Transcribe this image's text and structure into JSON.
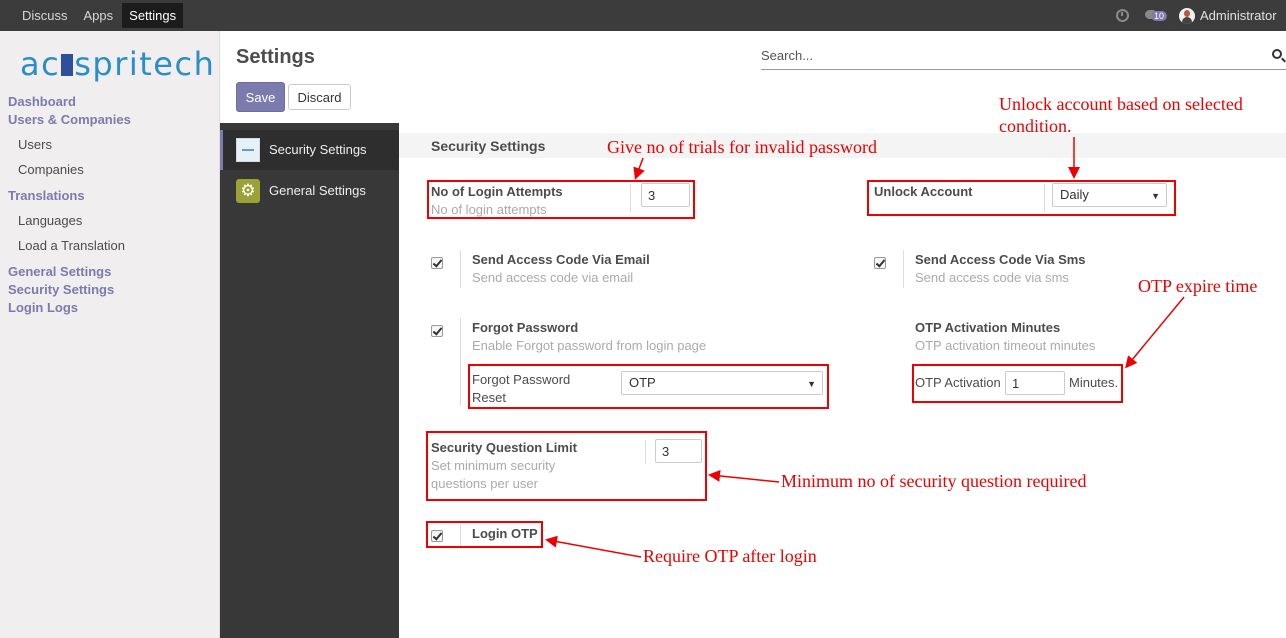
{
  "topbar": {
    "menu": [
      "Discuss",
      "Apps",
      "Settings"
    ],
    "active": "Settings",
    "chat_count": "10",
    "user_name": "Administrator"
  },
  "sidebar": {
    "logo_left": "ac",
    "logo_right": "spritech",
    "items": [
      {
        "label": "Dashboard",
        "type": "section"
      },
      {
        "label": "Users & Companies",
        "type": "section"
      },
      {
        "label": "Users",
        "type": "item"
      },
      {
        "label": "Companies",
        "type": "item"
      },
      {
        "label": "Translations",
        "type": "section"
      },
      {
        "label": "Languages",
        "type": "item"
      },
      {
        "label": "Load a Translation",
        "type": "item"
      },
      {
        "label": "General Settings",
        "type": "section"
      },
      {
        "label": "Security Settings",
        "type": "section"
      },
      {
        "label": "Login Logs",
        "type": "section"
      }
    ]
  },
  "header": {
    "title": "Settings",
    "search_placeholder": "Search...",
    "save_label": "Save",
    "discard_label": "Discard"
  },
  "settings_nav": [
    {
      "label": "Security Settings",
      "active": true,
      "icon": "security-app-icon"
    },
    {
      "label": "General Settings",
      "active": false,
      "icon": "gear-icon"
    }
  ],
  "section": {
    "title": "Security Settings",
    "login_attempts": {
      "label": "No of Login Attempts",
      "help": "No of login attempts",
      "value": "3"
    },
    "unlock_account": {
      "label": "Unlock Account",
      "value": "Daily"
    },
    "access_email": {
      "label": "Send Access Code Via Email",
      "help": "Send access code via email",
      "checked": true
    },
    "access_sms": {
      "label": "Send Access Code Via Sms",
      "help": "Send access code via sms",
      "checked": true
    },
    "forgot_password": {
      "label": "Forgot Password",
      "help": "Enable Forgot password from login page",
      "checked": true,
      "reset_label_1": "Forgot Password",
      "reset_label_2": "Reset",
      "reset_value": "OTP"
    },
    "otp_activation": {
      "label": "OTP Activation Minutes",
      "help": "OTP activation timeout minutes",
      "field_label": "OTP Activation",
      "value": "1",
      "suffix": "Minutes."
    },
    "security_question": {
      "label": "Security Question Limit",
      "help_1": "Set minimum security",
      "help_2": "questions per user",
      "value": "3"
    },
    "login_otp": {
      "label": "Login OTP",
      "checked": true
    }
  },
  "annotations": {
    "trials": "Give no of trials for invalid password",
    "unlock_1": "Unlock account based on selected",
    "unlock_2": "condition.",
    "otp_expire": "OTP expire time",
    "min_questions": "Minimum no of security question required",
    "require_otp": "Require OTP after login"
  },
  "colors": {
    "accent": "#7c7bad",
    "annotation": "#e00000",
    "topbar": "#3c3c3c",
    "settings_nav": "#383838"
  }
}
